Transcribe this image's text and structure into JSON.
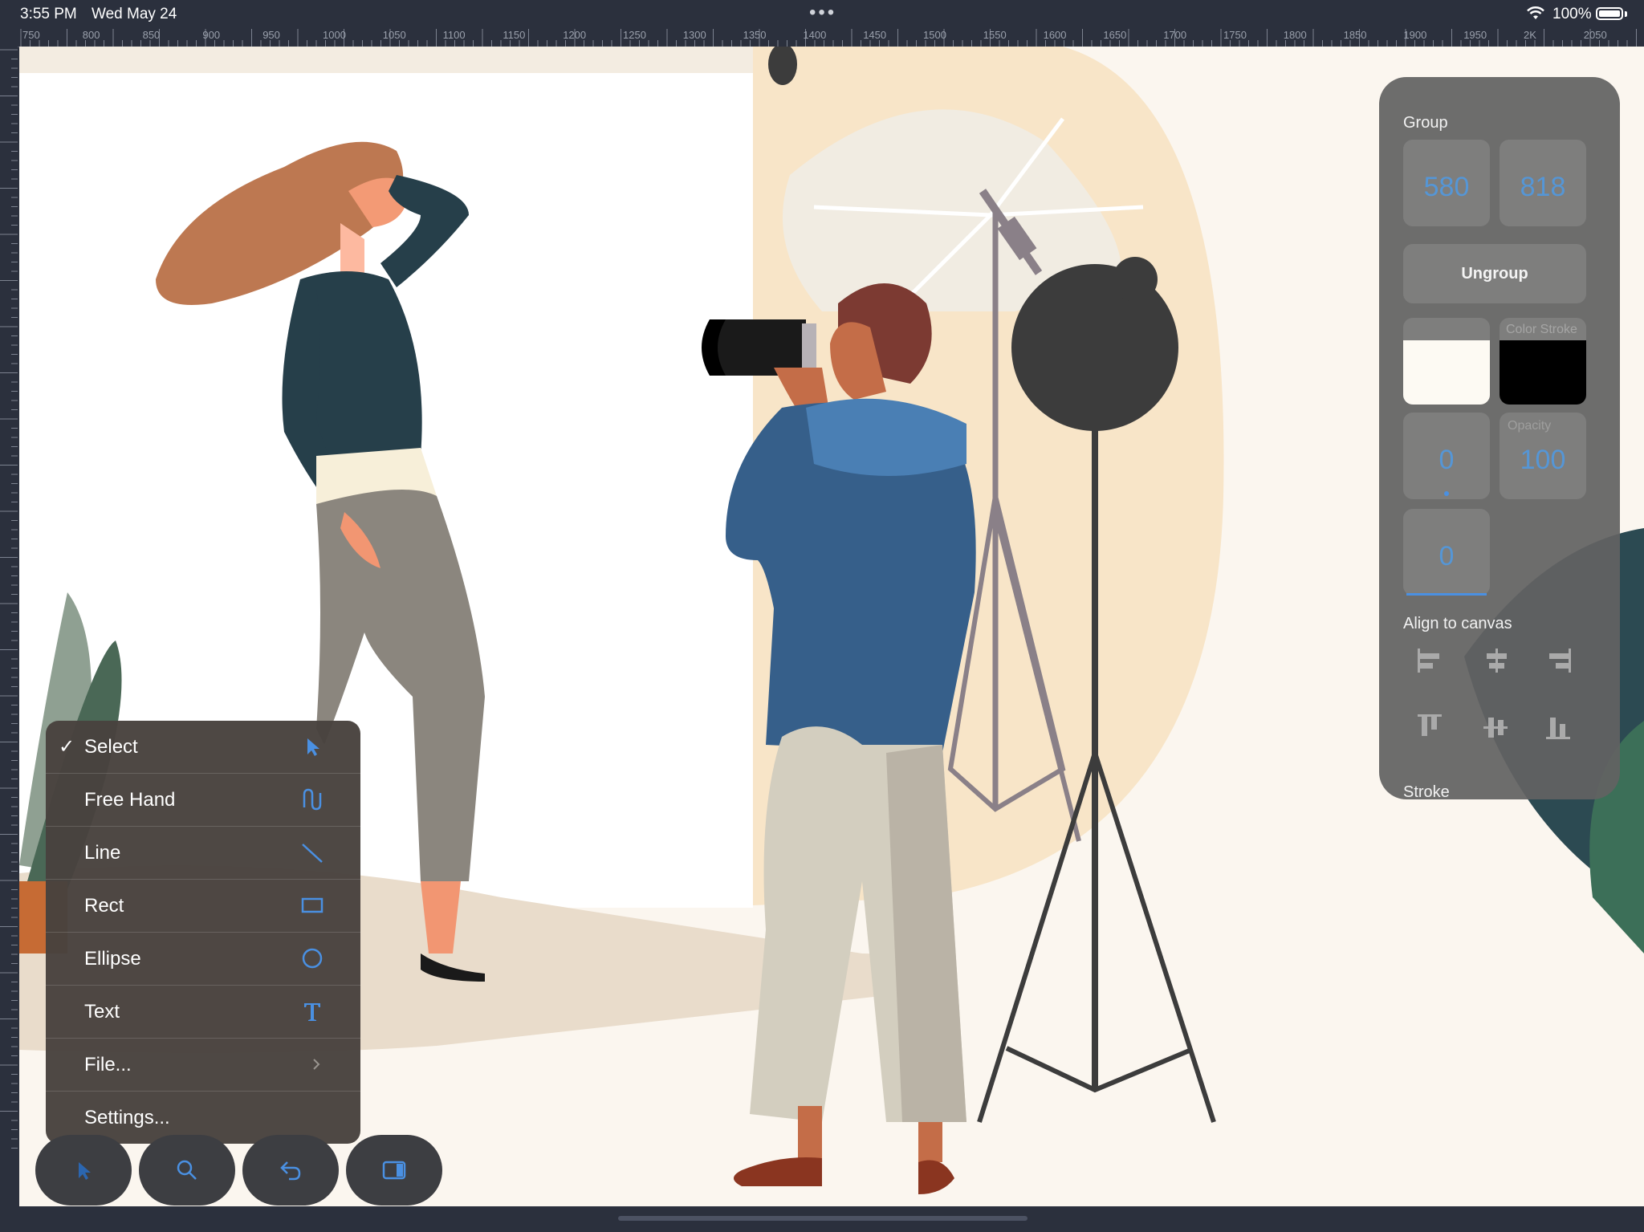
{
  "status_bar": {
    "time": "3:55 PM",
    "date": "Wed May 24",
    "battery": "100%"
  },
  "ruler": {
    "top_ticks": [
      "750",
      "800",
      "850",
      "900",
      "950",
      "1000",
      "1050",
      "1100",
      "1150",
      "1200",
      "1250",
      "1300",
      "1350",
      "1400",
      "1450",
      "1500",
      "1550",
      "1600",
      "1650",
      "1700",
      "1750",
      "1800",
      "1850",
      "1900",
      "1950",
      "2K",
      "2050"
    ]
  },
  "inspector": {
    "group_label": "Group",
    "width_value": "580",
    "height_value": "818",
    "ungroup_label": "Ungroup",
    "color_fill": "#fdfaf3",
    "stroke_caption": "Color Stroke",
    "color_stroke": "#000000",
    "opacity_caption": "Opacity",
    "rotation_value": "0",
    "opacity_value": "100",
    "corner_value": "0",
    "align_label": "Align to canvas",
    "align_buttons": [
      "align-left",
      "align-center-horizontal",
      "align-right",
      "align-top",
      "align-center-vertical",
      "align-bottom"
    ],
    "stroke_label": "Stroke"
  },
  "tool_menu": {
    "items": [
      {
        "label": "Select",
        "checked": true,
        "icon": "pointer-icon"
      },
      {
        "label": "Free Hand",
        "checked": false,
        "icon": "freehand-icon"
      },
      {
        "label": "Line",
        "checked": false,
        "icon": "line-icon"
      },
      {
        "label": "Rect",
        "checked": false,
        "icon": "rect-icon"
      },
      {
        "label": "Ellipse",
        "checked": false,
        "icon": "ellipse-icon"
      },
      {
        "label": "Text",
        "checked": false,
        "icon": "text-icon"
      },
      {
        "label": "File...",
        "checked": false,
        "icon": "chevron-right-icon"
      },
      {
        "label": "Settings...",
        "checked": false,
        "icon": ""
      }
    ]
  },
  "toolbar": {
    "buttons": [
      "pointer-icon",
      "search-icon",
      "undo-icon",
      "sidebar-icon"
    ]
  },
  "colors": {
    "accent": "#4a90e2",
    "canvas_bg": "#fbf6ef",
    "chrome": "#2b303d"
  }
}
